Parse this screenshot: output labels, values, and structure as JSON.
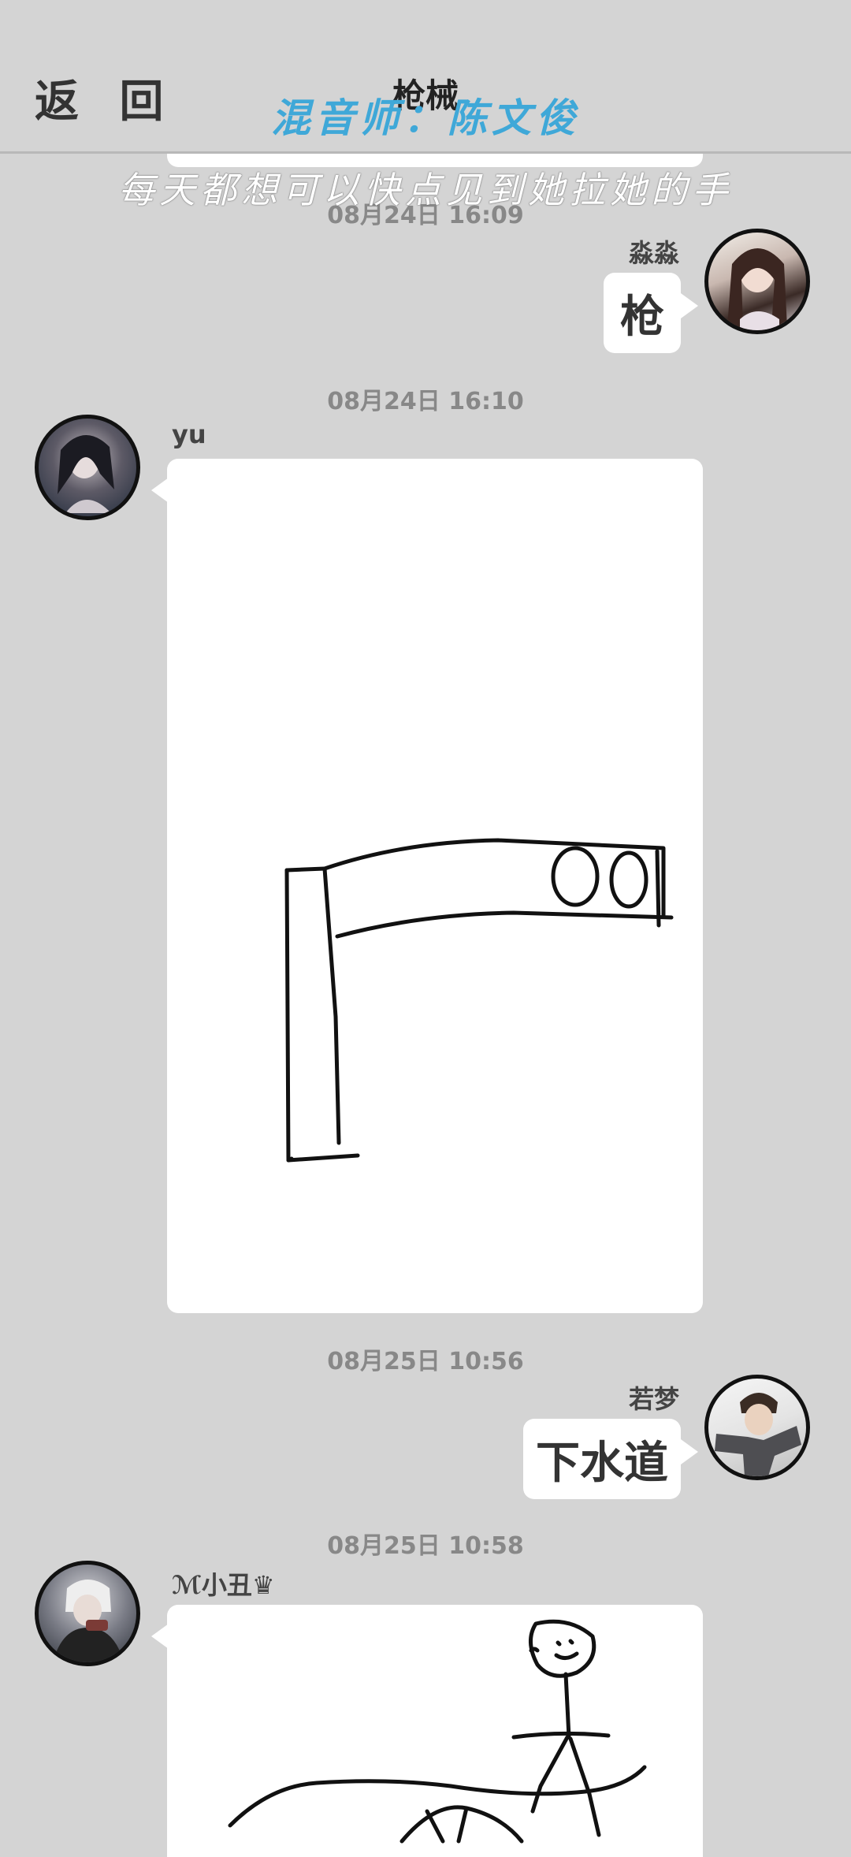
{
  "header": {
    "back_label": "返 回",
    "title": "枪械"
  },
  "overlay": {
    "credit": "混音师：陈文俊",
    "lyric": "每天都想可以快点见到她拉她的手"
  },
  "messages": [
    {
      "time": "08月24日  16:09",
      "sender": "淼淼",
      "side": "right",
      "text": "枪"
    },
    {
      "time": "08月24日  16:10",
      "sender": "yu",
      "side": "left",
      "type": "drawing"
    },
    {
      "time": "08月25日  10:56",
      "sender": "若梦",
      "side": "right",
      "text": "下水道"
    },
    {
      "time": "08月25日  10:58",
      "sender": "ℳ小丑♛",
      "side": "left",
      "type": "drawing"
    }
  ]
}
